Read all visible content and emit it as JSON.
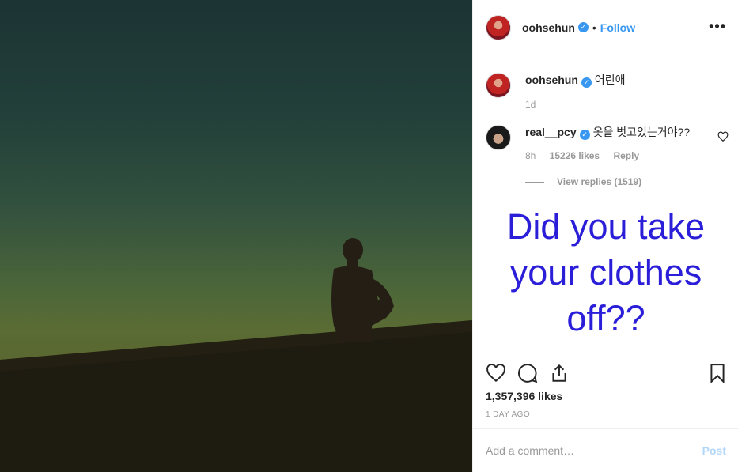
{
  "post": {
    "username": "oohsehun",
    "follow_label": "Follow",
    "dot": "•",
    "more_label": "•••"
  },
  "caption": {
    "username": "oohsehun",
    "text": "어린애",
    "time": "1d"
  },
  "comment": {
    "username": "real__pcy",
    "text": "옷을 벗고있는거야??",
    "time": "8h",
    "likes": "15226 likes",
    "reply_label": "Reply",
    "view_replies": "View replies (1519)"
  },
  "overlay_text": "Did you take your clothes off??",
  "actions": {
    "likes": "1,357,396 likes",
    "time_ago": "1 DAY AGO"
  },
  "comment_box": {
    "placeholder": "Add a comment…",
    "post_label": "Post"
  },
  "icons": [
    "heart-icon",
    "comment-icon",
    "share-icon",
    "bookmark-icon",
    "verified-badge-icon",
    "more-options-icon"
  ],
  "colors": {
    "accent": "#3897f0",
    "overlay_text": "#2b1ed8",
    "muted": "#999999"
  }
}
